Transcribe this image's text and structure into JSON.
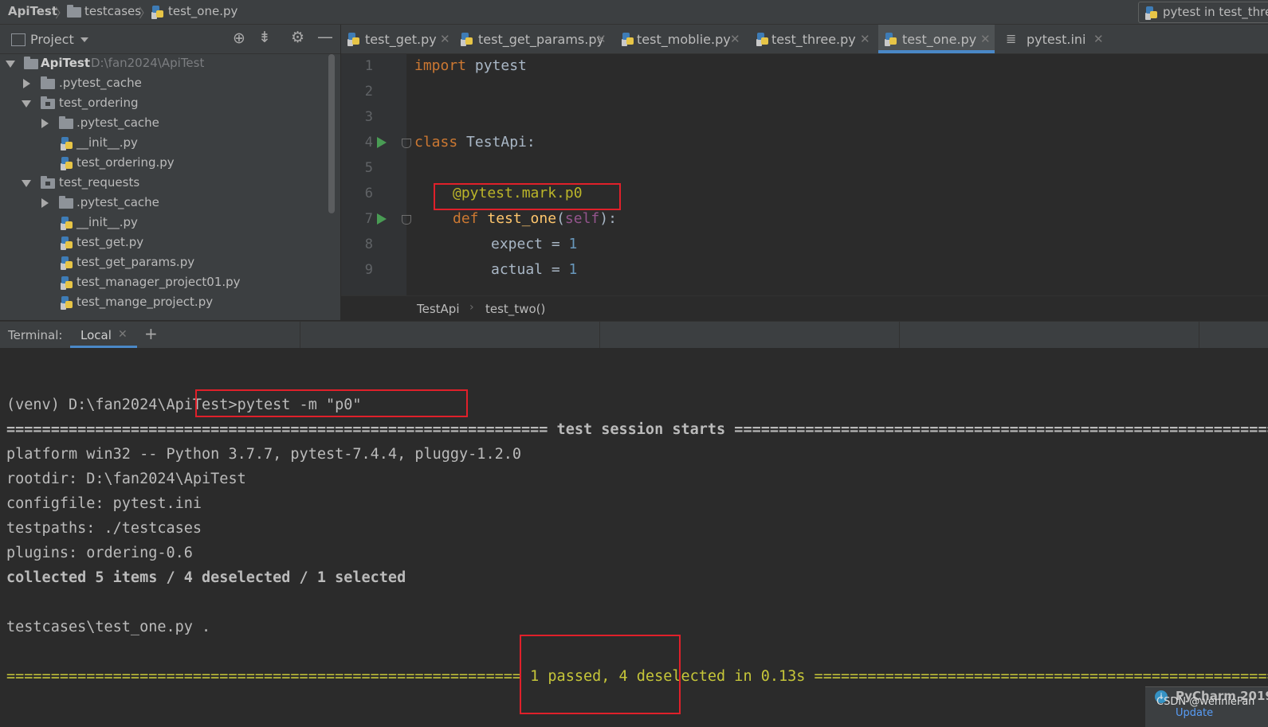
{
  "navbar": {
    "project": "ApiTest",
    "folder": "testcases",
    "file": "test_one.py",
    "run_config": "pytest in test_thre"
  },
  "project_panel": {
    "title": "Project",
    "tree": [
      {
        "label": "ApiTest",
        "path": "D:\\fan2024\\ApiTest",
        "type": "folder",
        "expanded": true
      },
      {
        "label": ".pytest_cache",
        "type": "folder",
        "expanded": false
      },
      {
        "label": "test_ordering",
        "type": "module",
        "expanded": true
      },
      {
        "label": ".pytest_cache",
        "type": "folder",
        "expanded": false
      },
      {
        "label": "__init__.py",
        "type": "py"
      },
      {
        "label": "test_ordering.py",
        "type": "py"
      },
      {
        "label": "test_requests",
        "type": "module",
        "expanded": true
      },
      {
        "label": ".pytest_cache",
        "type": "folder",
        "expanded": false
      },
      {
        "label": "__init__.py",
        "type": "py"
      },
      {
        "label": "test_get.py",
        "type": "py"
      },
      {
        "label": "test_get_params.py",
        "type": "py"
      },
      {
        "label": "test_manager_project01.py",
        "type": "py"
      },
      {
        "label": "test_mange_project.py",
        "type": "py"
      }
    ]
  },
  "tabs": [
    {
      "label": "test_get.py",
      "active": false
    },
    {
      "label": "test_get_params.py",
      "active": false
    },
    {
      "label": "test_moblie.py",
      "active": false
    },
    {
      "label": "test_three.py",
      "active": false
    },
    {
      "label": "test_one.py",
      "active": true
    },
    {
      "label": "pytest.ini",
      "active": false
    }
  ],
  "editor": {
    "line_numbers": [
      "1",
      "2",
      "3",
      "4",
      "5",
      "6",
      "7",
      "8",
      "9"
    ],
    "lines": {
      "l1_kw": "import",
      "l1_rest": " pytest",
      "l4_kw": "class",
      "l4_rest": " TestApi:",
      "l6_dec": "@pytest.mark.p0",
      "l7_kw": "def",
      "l7_fn": "test_one",
      "l7_self": "self",
      "l7_open": "(",
      "l7_close": "):",
      "l8_text": "expect = ",
      "l8_num": "1",
      "l9_text": "actual = ",
      "l9_num": "1"
    },
    "breadcrumb": [
      "TestApi",
      "test_two()"
    ]
  },
  "terminal": {
    "label": "Terminal:",
    "tab": "Local",
    "lines": {
      "prompt": "(venv) D:\\fan2024\\ApiTest>pytest -m \"p0\"",
      "session": "============================================================= test session starts =============================================================",
      "platform": "platform win32 -- Python 3.7.7, pytest-7.4.4, pluggy-1.2.0",
      "rootdir": "rootdir: D:\\fan2024\\ApiTest",
      "configfile": "configfile: pytest.ini",
      "testpaths": "testpaths: ./testcases",
      "plugins": "plugins: ordering-0.6",
      "collected": "collected 5 items / 4 deselected / 1 selected",
      "result_file": "testcases\\test_one.py .",
      "summary": "========================================================== 1 passed, 4 deselected in 0.13s =========================================================="
    }
  },
  "notification": {
    "title": "PyCharm 2019.",
    "watermark": "CSDN @wennieFan",
    "link": "Update"
  },
  "colors": {
    "keyword": "#cc7832",
    "decorator": "#bbb529",
    "function": "#ffc66d",
    "highlight_box": "#e0202a",
    "summary_yellow": "#c6c639"
  }
}
